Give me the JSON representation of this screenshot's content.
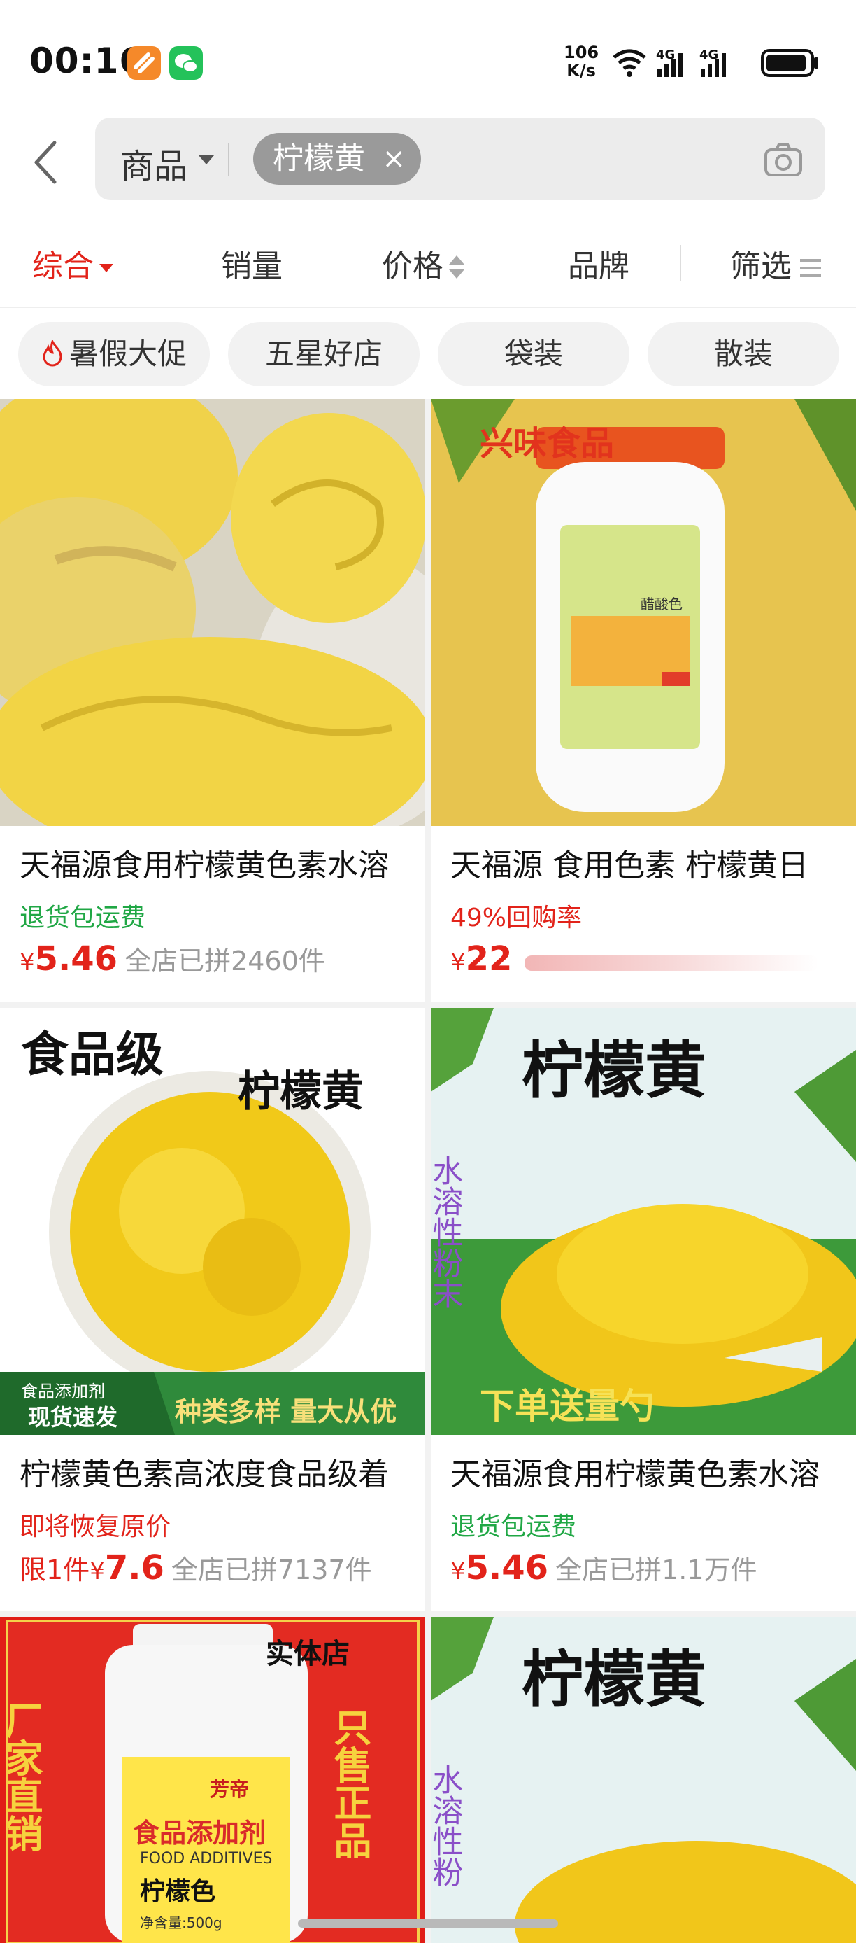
{
  "status_bar": {
    "time": "00:16",
    "net_speed_value": "106",
    "net_speed_unit": "K/s",
    "signal_1": "4G",
    "signal_2": "4G",
    "icons": [
      "orange-app-icon",
      "wechat-icon",
      "wifi-icon",
      "signal-icon",
      "signal-icon",
      "battery-icon"
    ]
  },
  "search": {
    "scope_label": "商品",
    "query_chip": "柠檬黄",
    "chip_close": "×"
  },
  "sort_tabs": [
    {
      "label": "综合",
      "active": true
    },
    {
      "label": "销量",
      "active": false
    },
    {
      "label": "价格",
      "active": false
    },
    {
      "label": "品牌",
      "active": false
    },
    {
      "label": "筛选",
      "active": false
    }
  ],
  "quick_filters": [
    {
      "label": "暑假大促"
    },
    {
      "label": "五星好店"
    },
    {
      "label": "袋装"
    },
    {
      "label": "散装"
    }
  ],
  "products": [
    {
      "title": "天福源食用柠檬黄色素水溶",
      "tag": "退货包运费",
      "tag_color": "#20a745",
      "currency": "¥",
      "price": "5.46",
      "sold": "全店已拼2460件"
    },
    {
      "title": "天福源 食用色素 柠檬黄日",
      "tag": "49%回购率",
      "tag_color": "#e2231a",
      "currency": "¥",
      "price": "22",
      "sold": "",
      "image_texts": {
        "brand": "兴味食品",
        "label_name": "醋酸色"
      }
    },
    {
      "title": "柠檬黄色素高浓度食品级着",
      "tag": "即将恢复原价",
      "tag_color": "#e2231a",
      "price_prefix": "限1件",
      "currency": "¥",
      "price": "7.6",
      "sold": "全店已拼7137件",
      "image_texts": {
        "headline": "食品级",
        "name": "柠檬黄",
        "badge_top": "食品添加剂",
        "badge_bottom": "现货速发",
        "slogan": "种类多样 量大从优"
      }
    },
    {
      "title": "天福源食用柠檬黄色素水溶",
      "tag": "退货包运费",
      "tag_color": "#20a745",
      "currency": "¥",
      "price": "5.46",
      "sold": "全店已拼1.1万件",
      "image_texts": {
        "name": "柠檬黄",
        "vertical": "水溶性粉末",
        "bottom": "下单送量勺"
      }
    },
    {
      "title": "",
      "image_texts": {
        "corner": "实体店",
        "left": "厂家直销",
        "right": "只售正品",
        "label_brand": "芳帝",
        "label_title": "食品添加剂",
        "label_en": "FOOD ADDITIVES",
        "label_name": "柠檬色",
        "label_weight": "净含量:500g"
      }
    },
    {
      "title": "",
      "image_texts": {
        "name": "柠檬黄",
        "vertical": "水溶性粉"
      }
    }
  ]
}
